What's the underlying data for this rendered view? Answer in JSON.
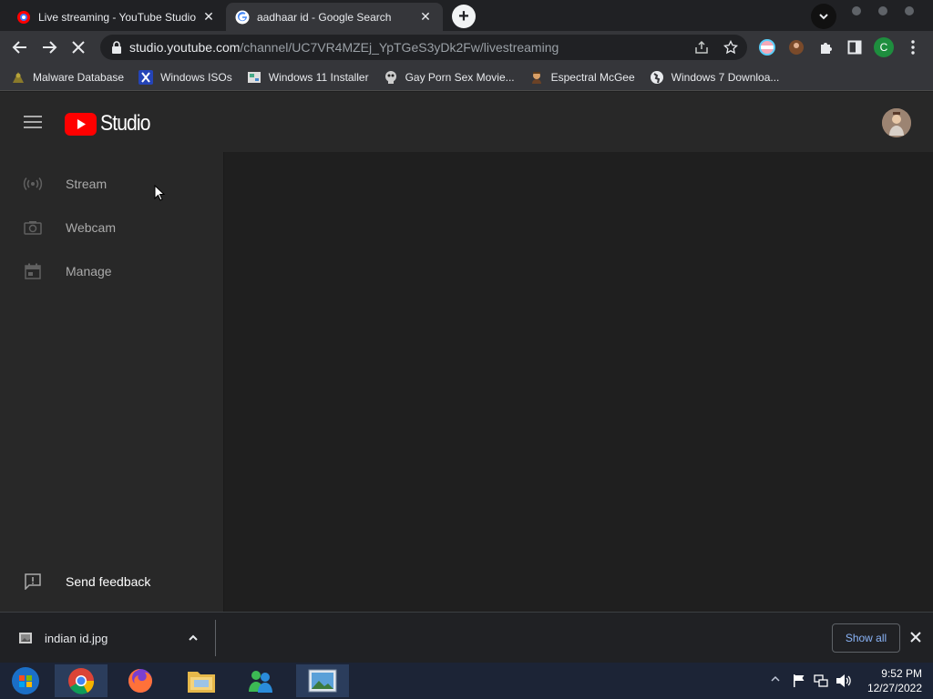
{
  "tabs": [
    {
      "title": "Live streaming - YouTube Studio",
      "icon": "youtube-live-icon",
      "active": false
    },
    {
      "title": "aadhaar id - Google Search",
      "icon": "google-g-icon",
      "active": true
    }
  ],
  "tab_close_glyph": "✕",
  "new_tab_glyph": "+",
  "address": {
    "host": "studio.youtube.com",
    "path": "/channel/UC7VR4MZEj_YpTGeS3yDk2Fw/livestreaming"
  },
  "profile_initial": "C",
  "bookmarks": [
    {
      "label": "Malware Database",
      "icon": "malware-icon"
    },
    {
      "label": "Windows ISOs",
      "icon": "x-icon"
    },
    {
      "label": "Windows 11 Installer",
      "icon": "page-icon"
    },
    {
      "label": "Gay Porn Sex Movie...",
      "icon": "skull-icon"
    },
    {
      "label": "Espectral McGee",
      "icon": "character-icon"
    },
    {
      "label": "Windows 7 Downloa...",
      "icon": "globe-icon"
    }
  ],
  "studio": {
    "logo_text": "Studio",
    "nav": [
      {
        "label": "Stream",
        "icon": "broadcast-icon"
      },
      {
        "label": "Webcam",
        "icon": "camera-icon"
      },
      {
        "label": "Manage",
        "icon": "calendar-icon"
      }
    ],
    "feedback_label": "Send feedback"
  },
  "download": {
    "filename": "indian id.jpg",
    "show_all": "Show all"
  },
  "taskbar": {
    "time": "9:52 PM",
    "date": "12/27/2022"
  },
  "colors": {
    "youtube_red": "#ff0000",
    "link_blue": "#8ab4f8",
    "profile_green": "#1e8e3e"
  }
}
